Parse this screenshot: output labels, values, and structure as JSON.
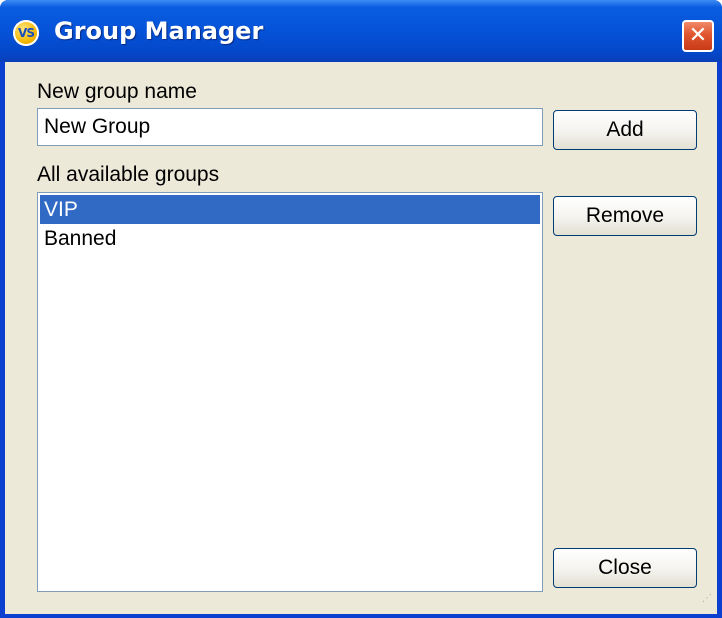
{
  "window": {
    "title": "Group Manager",
    "icon_text": "VS",
    "close_glyph": "✕"
  },
  "form": {
    "new_group_label": "New group name",
    "new_group_value": "New Group",
    "all_groups_label": "All available groups",
    "groups": [
      {
        "name": "VIP",
        "selected": true
      },
      {
        "name": "Banned",
        "selected": false
      }
    ]
  },
  "buttons": {
    "add_label": "Add",
    "remove_label": "Remove",
    "close_label": "Close"
  },
  "colors": {
    "titlebar": "#0553d8",
    "selection": "#316ac5",
    "dialog_bg": "#ece9d8",
    "close_button": "#e0552e"
  }
}
